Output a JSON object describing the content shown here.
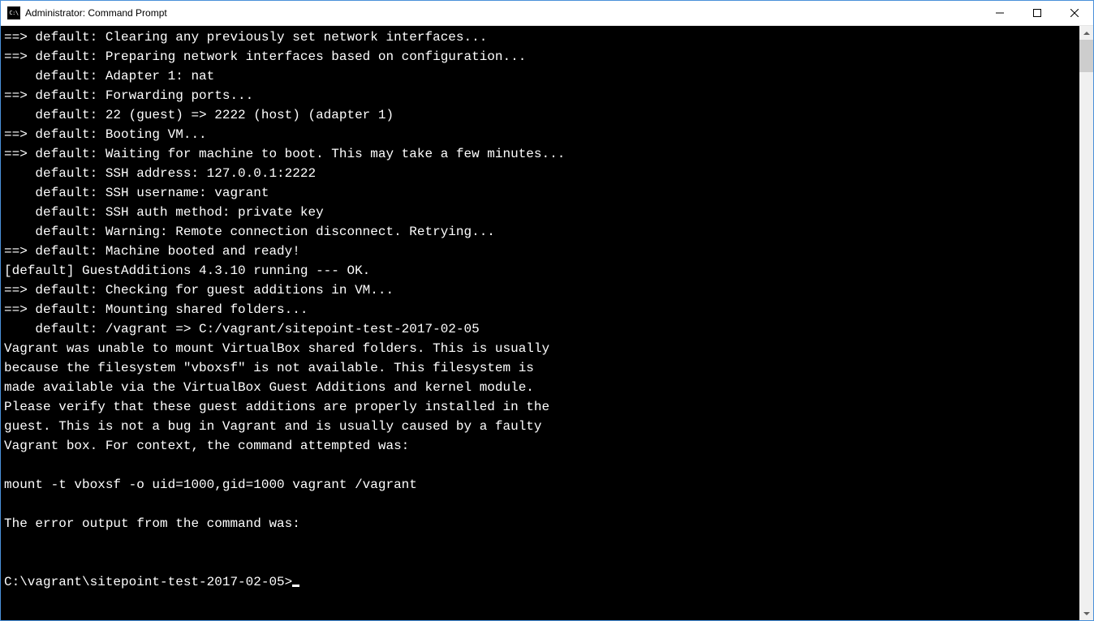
{
  "window": {
    "title": "Administrator: Command Prompt",
    "icon_label": "C:\\"
  },
  "terminal": {
    "lines": [
      "==> default: Clearing any previously set network interfaces...",
      "==> default: Preparing network interfaces based on configuration...",
      "    default: Adapter 1: nat",
      "==> default: Forwarding ports...",
      "    default: 22 (guest) => 2222 (host) (adapter 1)",
      "==> default: Booting VM...",
      "==> default: Waiting for machine to boot. This may take a few minutes...",
      "    default: SSH address: 127.0.0.1:2222",
      "    default: SSH username: vagrant",
      "    default: SSH auth method: private key",
      "    default: Warning: Remote connection disconnect. Retrying...",
      "==> default: Machine booted and ready!",
      "[default] GuestAdditions 4.3.10 running --- OK.",
      "==> default: Checking for guest additions in VM...",
      "==> default: Mounting shared folders...",
      "    default: /vagrant => C:/vagrant/sitepoint-test-2017-02-05",
      "Vagrant was unable to mount VirtualBox shared folders. This is usually",
      "because the filesystem \"vboxsf\" is not available. This filesystem is",
      "made available via the VirtualBox Guest Additions and kernel module.",
      "Please verify that these guest additions are properly installed in the",
      "guest. This is not a bug in Vagrant and is usually caused by a faulty",
      "Vagrant box. For context, the command attempted was:",
      "",
      "mount -t vboxsf -o uid=1000,gid=1000 vagrant /vagrant",
      "",
      "The error output from the command was:",
      "",
      ""
    ],
    "prompt": "C:\\vagrant\\sitepoint-test-2017-02-05>"
  }
}
